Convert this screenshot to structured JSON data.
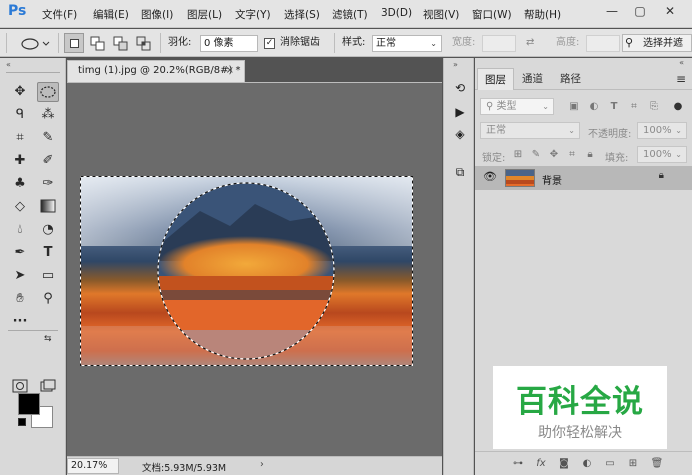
{
  "menubar": {
    "logo": "Ps",
    "items": [
      "文件(F)",
      "编辑(E)",
      "图像(I)",
      "图层(L)",
      "文字(Y)",
      "选择(S)",
      "滤镜(T)",
      "3D(D)",
      "视图(V)",
      "窗口(W)",
      "帮助(H)"
    ],
    "window_controls": {
      "minimize": "—",
      "maximize": "▢",
      "close": "✕"
    }
  },
  "options": {
    "feather_label": "羽化:",
    "feather_value": "0 像素",
    "antialias_label": "消除锯齿",
    "antialias_checked": "✓",
    "style_label": "样式:",
    "style_value": "正常",
    "width_label": "宽度:",
    "height_label": "高度:",
    "select_mask_label": "选择并遮"
  },
  "document": {
    "tab_title": "timg (1).jpg @ 20.2%(RGB/8#) *",
    "tab_close": "×",
    "zoom": "20.17%",
    "doc_info": "文档:5.93M/5.93M",
    "status_arrow": "›"
  },
  "colors": {
    "foreground": "#000000",
    "background": "#ffffff",
    "brand": "#2b7ad6",
    "watermark_green": "#27a844"
  },
  "layers_panel": {
    "tabs": [
      "图层",
      "通道",
      "路径"
    ],
    "active_tab": "图层",
    "filter_kind": "类型",
    "blend_mode": "正常",
    "opacity_label": "不透明度:",
    "opacity_value": "100%",
    "lock_label": "锁定:",
    "fill_label": "填充:",
    "fill_value": "100%",
    "layers": [
      {
        "name": "背景",
        "visible": true,
        "locked": true
      }
    ],
    "footer_icons": [
      "link-icon",
      "fx-icon",
      "mask-icon",
      "adjustment-icon",
      "group-icon",
      "new-layer-icon",
      "delete-icon"
    ]
  },
  "watermark": {
    "title": "百科全说",
    "subtitle": "助你轻松解决"
  }
}
